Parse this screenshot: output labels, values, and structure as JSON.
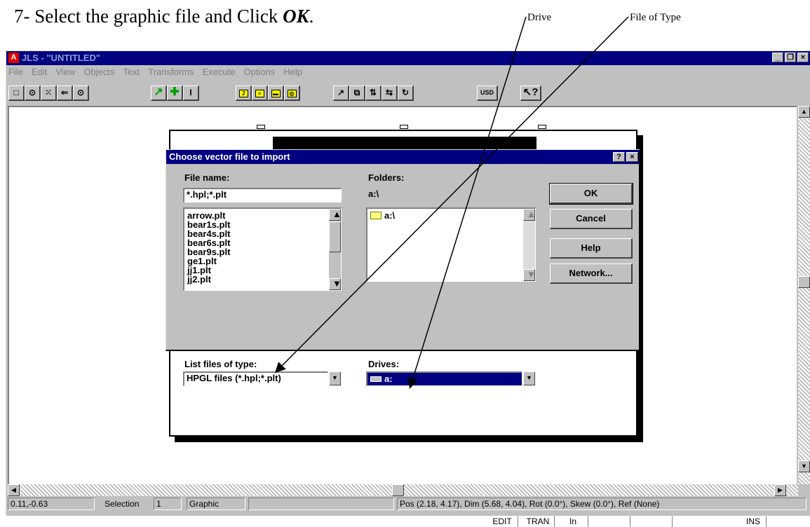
{
  "instruction": {
    "prefix": "7-  Select the graphic file and Click ",
    "emphasis": "OK",
    "suffix": "."
  },
  "callouts": {
    "drive": "Drive",
    "file_type": "File of Type"
  },
  "app": {
    "title": "JLS - \"UNTITLED\"",
    "logo": "A",
    "window_buttons": {
      "minimize": "_",
      "restore": "❐",
      "close": "×"
    },
    "menu": [
      "File",
      "Edit",
      "View",
      "Objects",
      "Text",
      "Transforms",
      "Execute",
      "Options",
      "Help"
    ],
    "toolbar": {
      "usd": "USD",
      "help": "↖?"
    }
  },
  "dialog": {
    "title": "Choose vector file to import",
    "help_button": "?",
    "close_button": "×",
    "file_name_label": "File name:",
    "file_name_value": "*.hpl;*.plt",
    "files": [
      "arrow.plt",
      "bear1s.plt",
      "bear4s.plt",
      "bear6s.plt",
      "bear9s.plt",
      "ge1.plt",
      "jj1.plt",
      "jj2.plt"
    ],
    "folders_label": "Folders:",
    "current_folder": "a:\\",
    "folder_items": [
      "a:\\"
    ],
    "type_label": "List files of type:",
    "type_value": "HPGL files (*.hpl;*.plt)",
    "drives_label": "Drives:",
    "drive_value": "a:",
    "buttons": {
      "ok": "OK",
      "cancel": "Cancel",
      "help": "Help",
      "network": "Network..."
    }
  },
  "status": {
    "coords": "0.11,-0.63",
    "selection_label": "Selection",
    "selection_count": "1",
    "object_type": "Graphic",
    "geometry": "Pos (2.18, 4.17), Dim (5.68, 4.04), Rot (0.0°), Skew (0.0°), Ref (None)",
    "modes": [
      "EDIT",
      "TRAN",
      "In",
      "",
      "",
      "INS"
    ]
  }
}
